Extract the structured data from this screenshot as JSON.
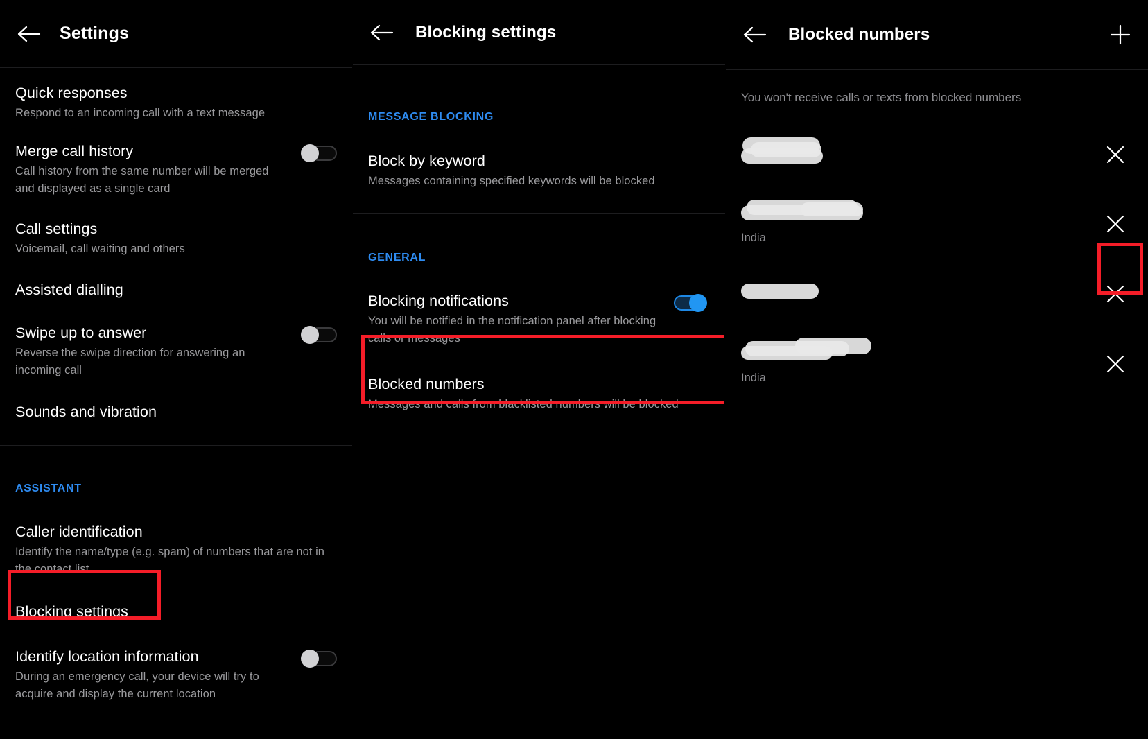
{
  "theme": {
    "background": "#000000",
    "accent_blue": "#2e8bf0",
    "toggle_on": "#2196f3",
    "highlight_red": "#f41d28",
    "title_color": "#ffffff",
    "subtitle_color": "#9a9a9d"
  },
  "panels": [
    {
      "id": "settings",
      "appbar": {
        "back_icon": "arrow-left-icon",
        "title": "Settings"
      },
      "groups": [
        {
          "items": [
            {
              "title": "Quick responses",
              "subtitle": "Respond to an incoming call with a text message",
              "control": "none"
            },
            {
              "title": "Merge call history",
              "subtitle": "Call history from the same number will be merged and displayed as a single card",
              "control": "toggle",
              "toggle_on": false
            },
            {
              "title": "Call settings",
              "subtitle": "Voicemail, call waiting and others",
              "control": "none"
            },
            {
              "title": "Assisted dialling",
              "subtitle": "",
              "control": "none"
            },
            {
              "title": "Swipe up to answer",
              "subtitle": "Reverse the swipe direction for answering an incoming call",
              "control": "toggle",
              "toggle_on": false
            },
            {
              "title": "Sounds and vibration",
              "subtitle": "",
              "control": "none"
            }
          ]
        },
        {
          "header": "ASSISTANT",
          "items": [
            {
              "title": "Caller identification",
              "subtitle": "Identify the name/type (e.g. spam) of numbers that are not in the contact list",
              "control": "none"
            },
            {
              "title": "Blocking settings",
              "subtitle": "",
              "control": "none",
              "highlighted": true
            },
            {
              "title": "Identify location information",
              "subtitle": "During an emergency call, your device will try to acquire and display the current location",
              "control": "toggle",
              "toggle_on": false
            }
          ]
        }
      ]
    },
    {
      "id": "blocking-settings",
      "appbar": {
        "back_icon": "arrow-left-icon",
        "title": "Blocking settings"
      },
      "groups": [
        {
          "header": "MESSAGE BLOCKING",
          "items": [
            {
              "title": "Block by keyword",
              "subtitle": "Messages containing specified keywords will be blocked",
              "control": "none"
            }
          ]
        },
        {
          "header": "GENERAL",
          "items": [
            {
              "title": "Blocking notifications",
              "subtitle": "You will be notified in the notification panel after blocking calls or messages",
              "control": "toggle",
              "toggle_on": true
            },
            {
              "title": "Blocked numbers",
              "subtitle": "Messages and calls from blacklisted numbers will be blocked",
              "control": "none",
              "highlighted": true
            }
          ]
        }
      ]
    },
    {
      "id": "blocked-numbers",
      "appbar": {
        "back_icon": "arrow-left-icon",
        "title": "Blocked numbers",
        "action_icon": "plus-icon"
      },
      "note": "You won't receive calls or texts from blocked numbers",
      "entries": [
        {
          "number": "",
          "redacted": true,
          "country": "",
          "remove_icon": "close-icon",
          "highlighted": false
        },
        {
          "number": "",
          "redacted": true,
          "country": "India",
          "remove_icon": "close-icon",
          "highlighted": false
        },
        {
          "number": "",
          "redacted": true,
          "country": "",
          "remove_icon": "close-icon",
          "highlighted": true
        },
        {
          "number": "",
          "redacted": true,
          "country": "India",
          "remove_icon": "close-icon",
          "highlighted": false
        }
      ]
    }
  ]
}
